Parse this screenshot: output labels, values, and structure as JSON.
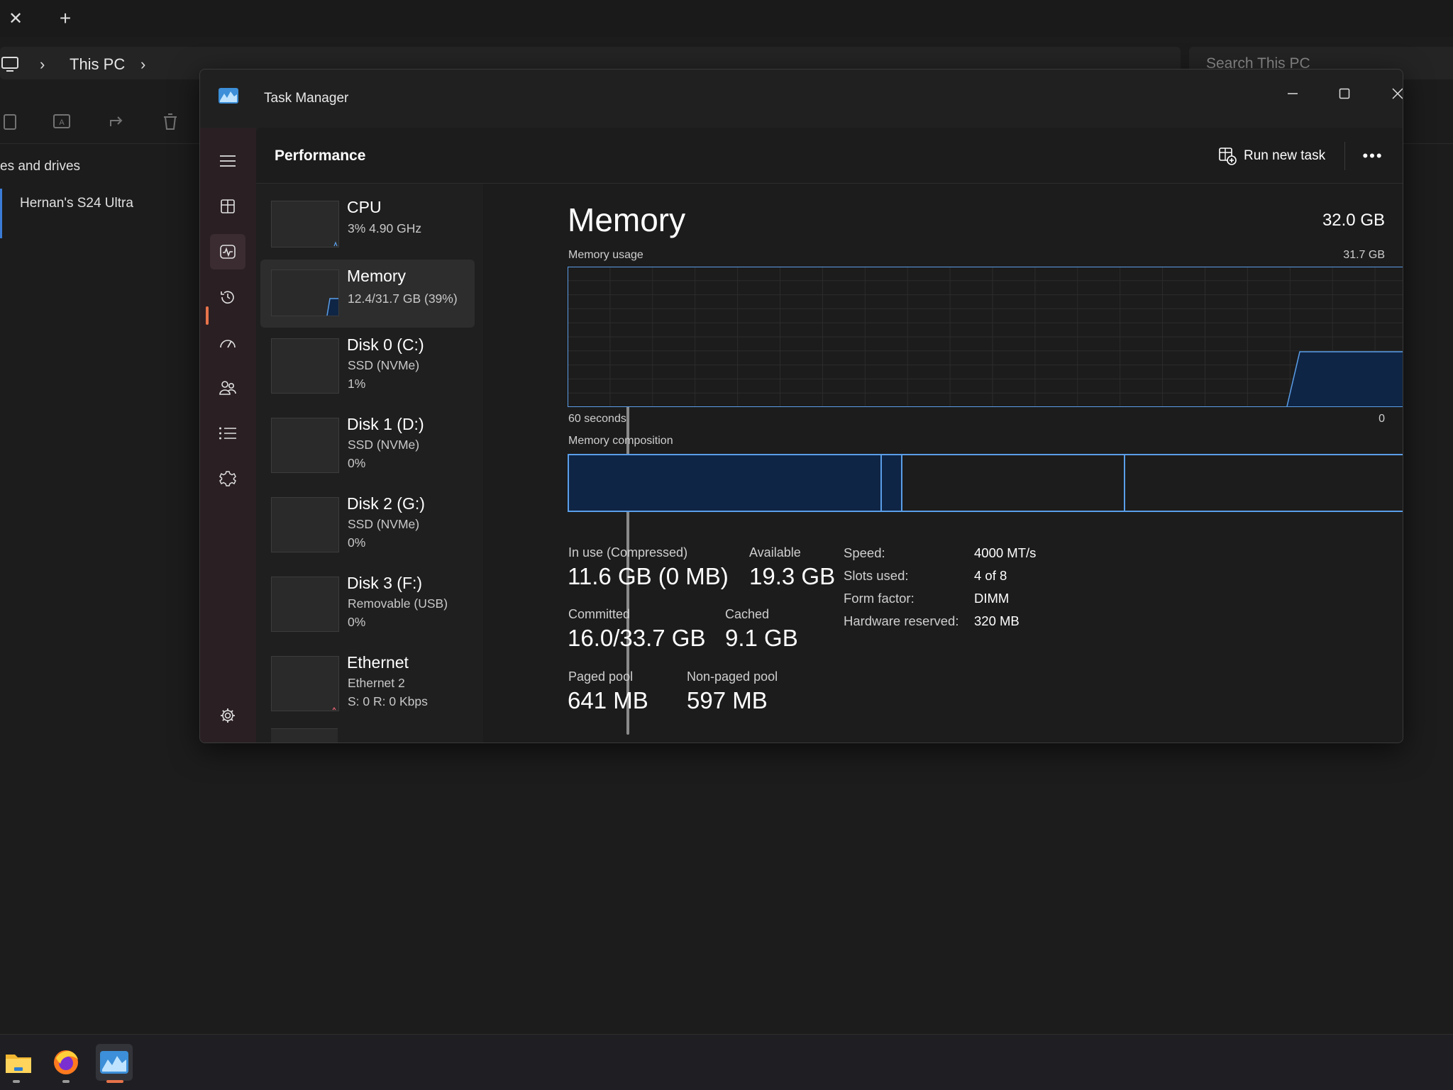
{
  "file_explorer": {
    "breadcrumb": "This PC",
    "search_placeholder": "Search This PC",
    "nav_heading": "es and drives",
    "nav_item": "Hernan's S24 Ultra"
  },
  "task_manager": {
    "title": "Task Manager",
    "page_title": "Performance",
    "run_new_task": "Run new task",
    "more_label": "•••",
    "devices": [
      {
        "name": "CPU",
        "line1": "3%  4.90 GHz",
        "line2": ""
      },
      {
        "name": "Memory",
        "line1": "12.4/31.7 GB (39%)",
        "line2": ""
      },
      {
        "name": "Disk 0 (C:)",
        "line1": "SSD (NVMe)",
        "line2": "1%"
      },
      {
        "name": "Disk 1 (D:)",
        "line1": "SSD (NVMe)",
        "line2": "0%"
      },
      {
        "name": "Disk 2 (G:)",
        "line1": "SSD (NVMe)",
        "line2": "0%"
      },
      {
        "name": "Disk 3 (F:)",
        "line1": "Removable (USB)",
        "line2": "0%"
      },
      {
        "name": "Ethernet",
        "line1": "Ethernet 2",
        "line2": "S: 0  R: 0 Kbps"
      }
    ],
    "memory": {
      "title": "Memory",
      "total": "32.0 GB",
      "usage_label": "Memory usage",
      "usage_max": "31.7 GB",
      "x_left": "60 seconds",
      "x_right": "0",
      "composition_label": "Memory composition",
      "in_use_label": "In use (Compressed)",
      "in_use_value": "11.6 GB (0 MB)",
      "available_label": "Available",
      "available_value": "19.3 GB",
      "committed_label": "Committed",
      "committed_value": "16.0/33.7 GB",
      "cached_label": "Cached",
      "cached_value": "9.1 GB",
      "paged_label": "Paged pool",
      "paged_value": "641 MB",
      "nonpaged_label": "Non-paged pool",
      "nonpaged_value": "597 MB",
      "specs": [
        {
          "label": "Speed:",
          "value": "4000 MT/s"
        },
        {
          "label": "Slots used:",
          "value": "4 of 8"
        },
        {
          "label": "Form factor:",
          "value": "DIMM"
        },
        {
          "label": "Hardware reserved:",
          "value": "320 MB"
        }
      ]
    }
  },
  "colors": {
    "accent": "#e8734a",
    "graph_line": "#5a9ee8",
    "graph_fill": "#0f2545",
    "graph_grid": "#2c2c2c"
  }
}
